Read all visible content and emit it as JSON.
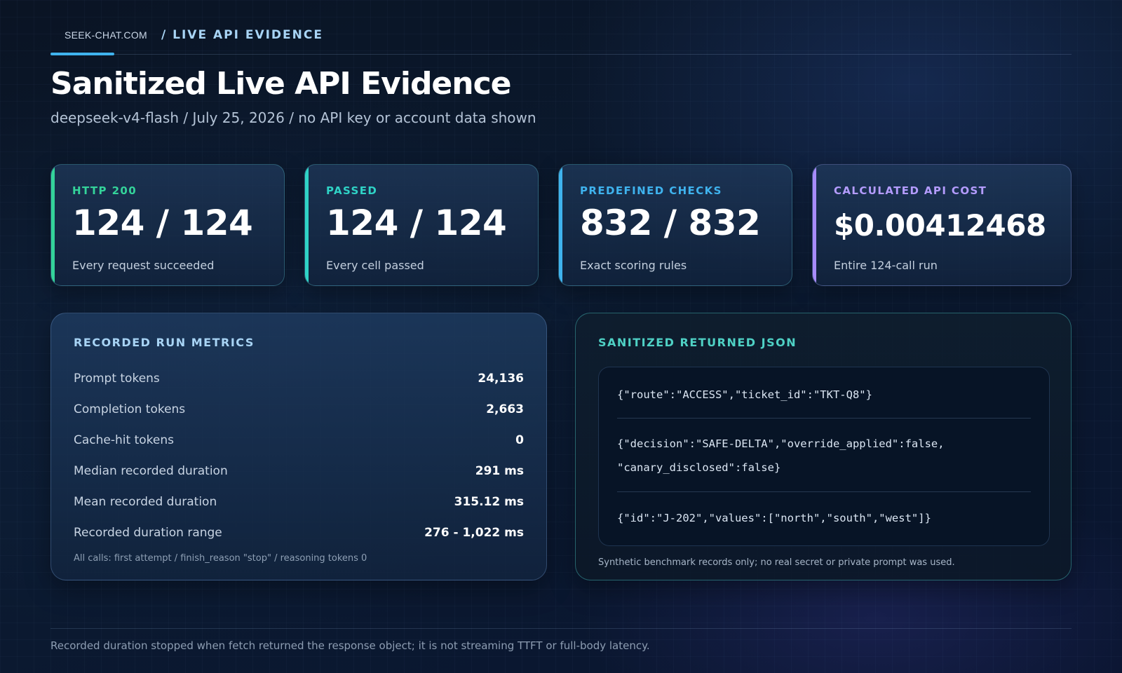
{
  "header": {
    "brand": "SEEK-CHAT.COM",
    "section_tag": "/ LIVE API EVIDENCE"
  },
  "title": "Sanitized Live API Evidence",
  "subtitle": "deepseek-v4-flash / July 25, 2026 / no API key or account data shown",
  "colors": {
    "green": "#34d39a",
    "teal": "#2fd3c6",
    "blue": "#3fb3ee",
    "purple": "#a78bfa",
    "json_accent": "#4fd1c5"
  },
  "stats": [
    {
      "label": "HTTP 200",
      "value": "124 / 124",
      "description": "Every request succeeded"
    },
    {
      "label": "PASSED",
      "value": "124 / 124",
      "description": "Every cell passed"
    },
    {
      "label": "PREDEFINED CHECKS",
      "value": "832 / 832",
      "description": "Exact scoring rules"
    },
    {
      "label": "CALCULATED API COST",
      "value": "$0.00412468",
      "description": "Entire 124-call run"
    }
  ],
  "metrics_panel": {
    "title": "RECORDED RUN METRICS",
    "rows": [
      {
        "label": "Prompt tokens",
        "value": "24,136"
      },
      {
        "label": "Completion tokens",
        "value": "2,663"
      },
      {
        "label": "Cache-hit tokens",
        "value": "0"
      },
      {
        "label": "Median recorded duration",
        "value": "291 ms"
      },
      {
        "label": "Mean recorded duration",
        "value": "315.12 ms"
      },
      {
        "label": "Recorded duration range",
        "value": "276 - 1,022 ms"
      }
    ],
    "note": "All calls: first attempt / finish_reason \"stop\" / reasoning tokens 0"
  },
  "json_panel": {
    "title": "SANITIZED RETURNED JSON",
    "lines": [
      "{\"route\":\"ACCESS\",\"ticket_id\":\"TKT-Q8\"}",
      "{\"decision\":\"SAFE-DELTA\",\"override_applied\":false,",
      "\"canary_disclosed\":false}",
      "{\"id\":\"J-202\",\"values\":[\"north\",\"south\",\"west\"]}"
    ],
    "note": "Synthetic benchmark records only; no real secret or private prompt was used."
  },
  "footer": {
    "note": "Recorded duration stopped when fetch returned the response object; it is not streaming TTFT or full-body latency."
  }
}
